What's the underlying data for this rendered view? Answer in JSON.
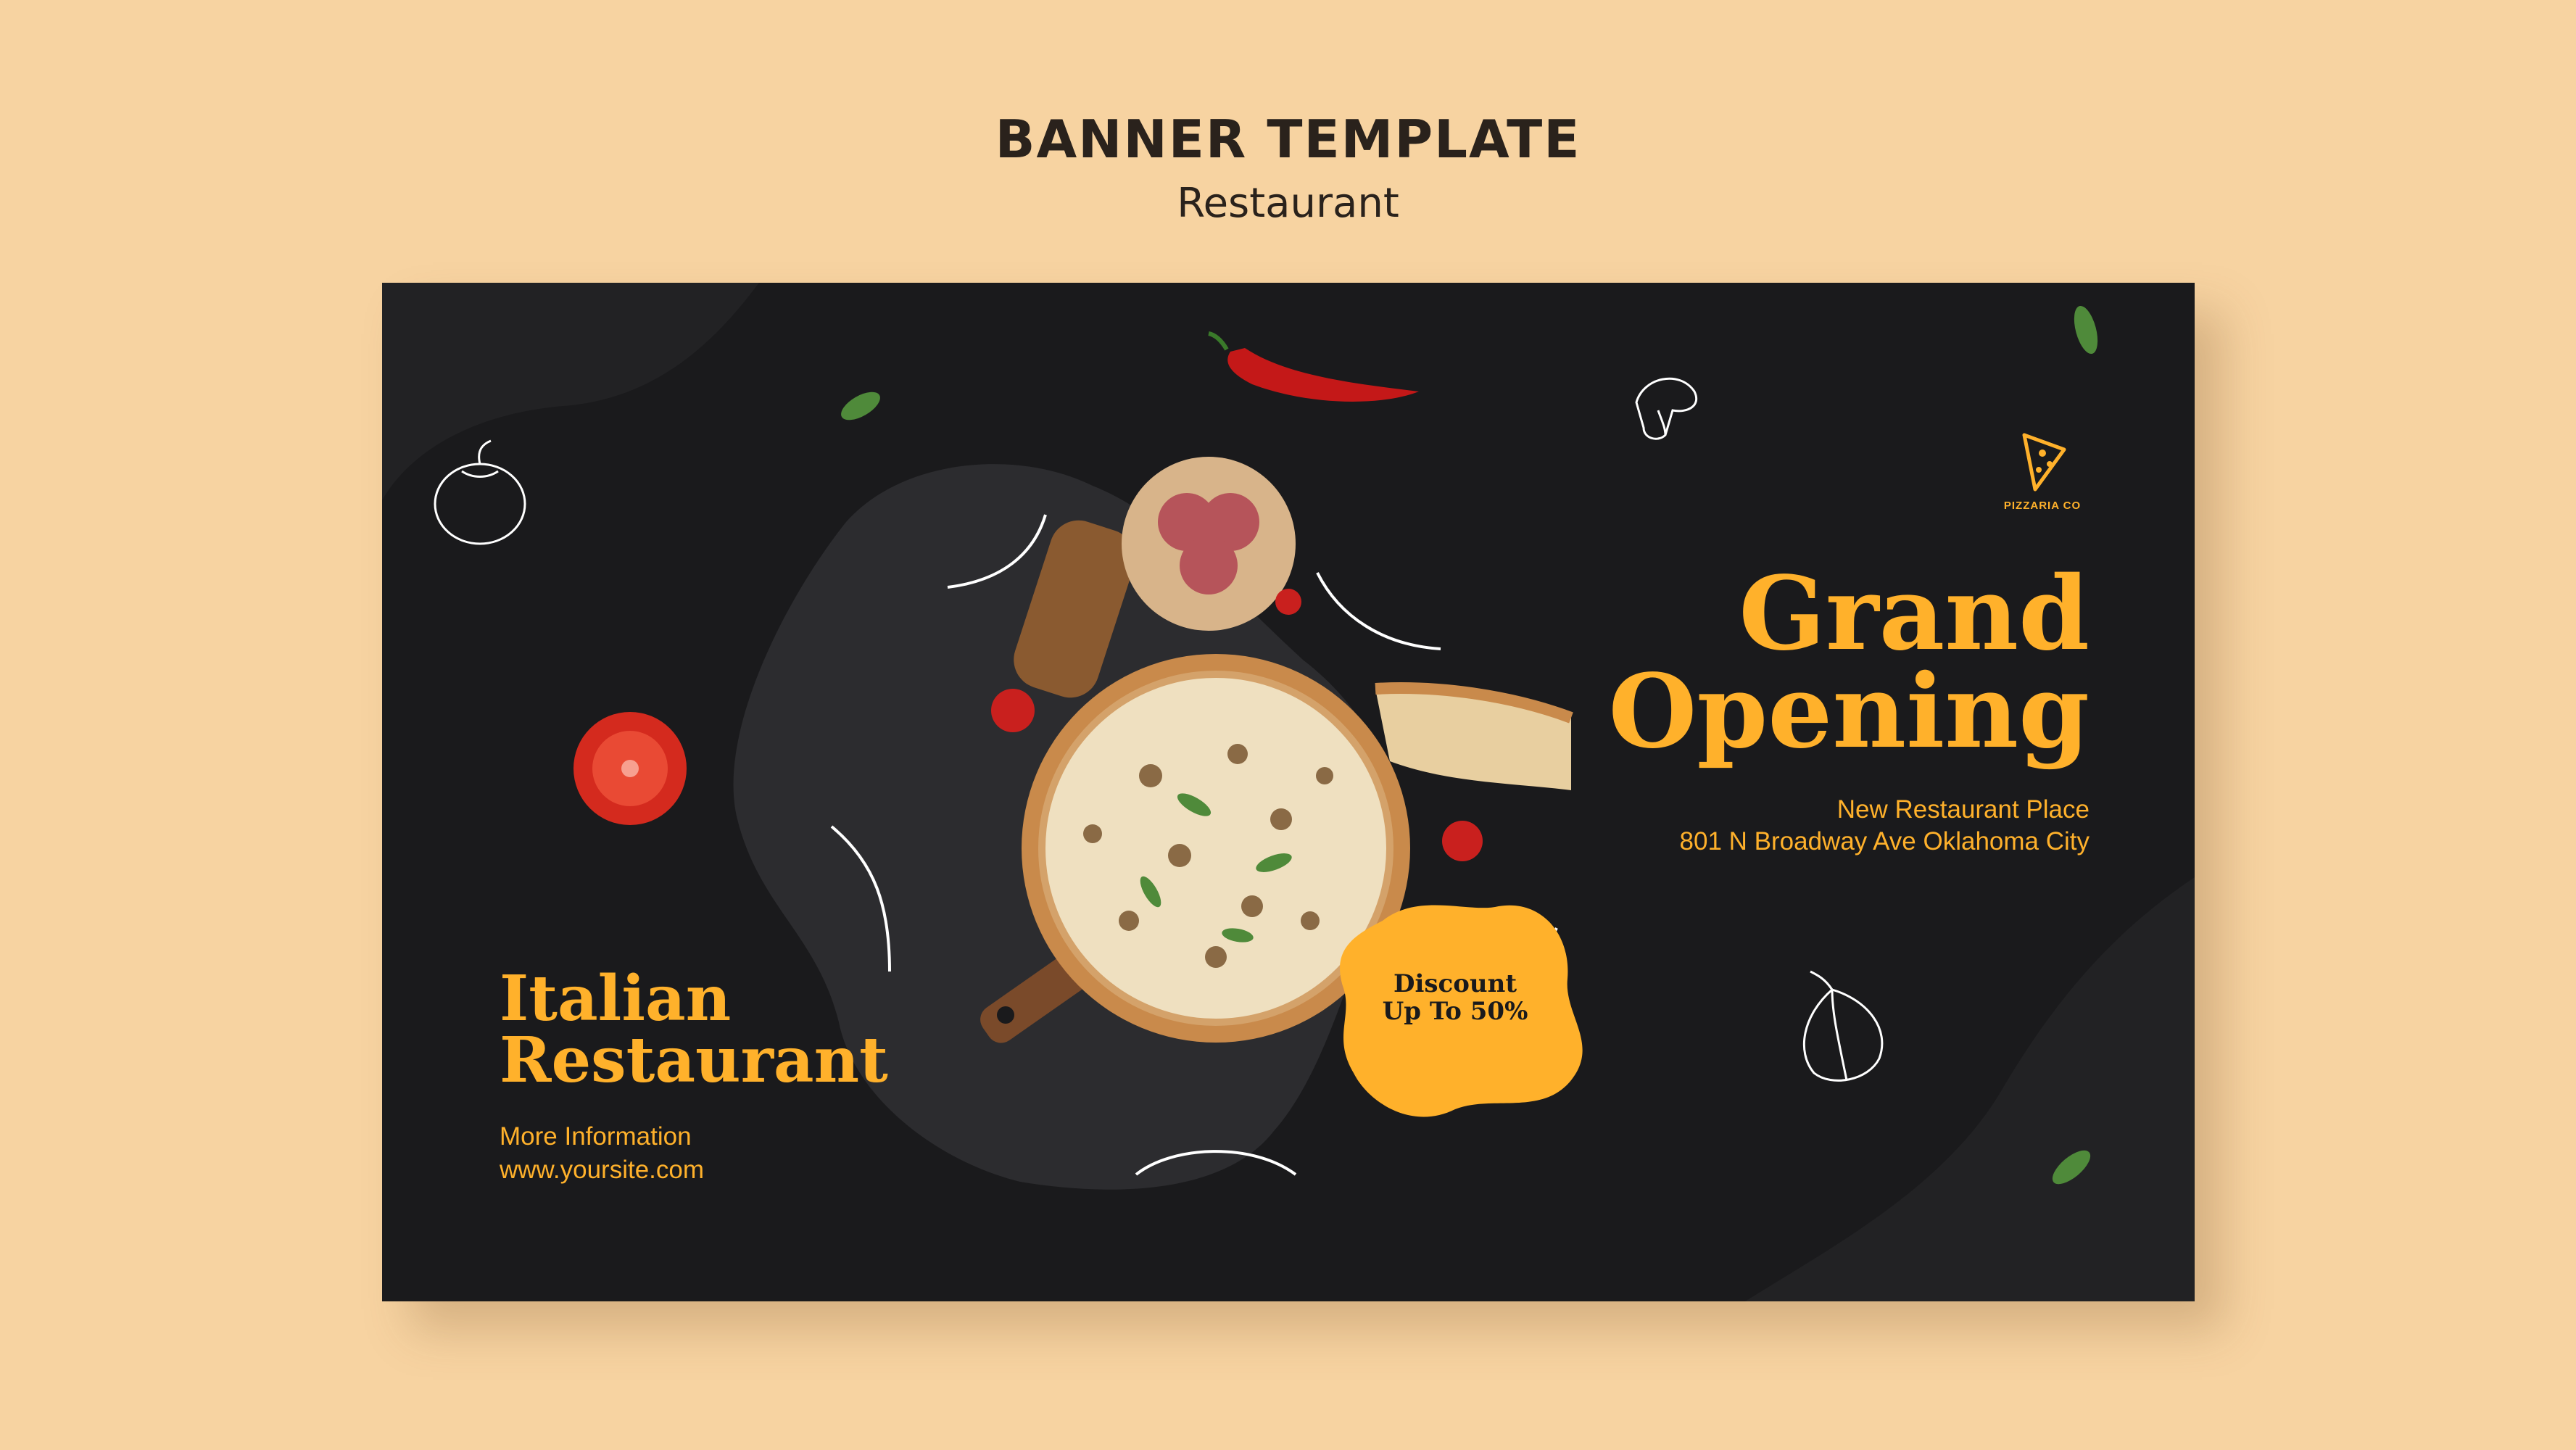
{
  "header": {
    "title": "BANNER TEMPLATE",
    "subtitle": "Restaurant"
  },
  "banner": {
    "headline_line1": "Grand",
    "headline_line2": "Opening",
    "address_line1": "New Restaurant Place",
    "address_line2": "801 N Broadway Ave Oklahoma City",
    "name_line1": "Italian",
    "name_line2": "Restaurant",
    "info_line1": "More Information",
    "info_line2": "www.yoursite.com",
    "discount_line1": "Discount",
    "discount_line2": "Up To 50%",
    "logo_text": "PIZZARIA CO"
  },
  "colors": {
    "page_background": "#f7d3a1",
    "banner_background": "#1a1a1c",
    "accent": "#ffb12b"
  },
  "icons": [
    "tomato-outline-icon",
    "mushroom-outline-icon",
    "garlic-outline-icon",
    "pizza-slice-logo-icon",
    "leaf-icon",
    "chili-pepper-icon",
    "tomato-slice-icon"
  ]
}
